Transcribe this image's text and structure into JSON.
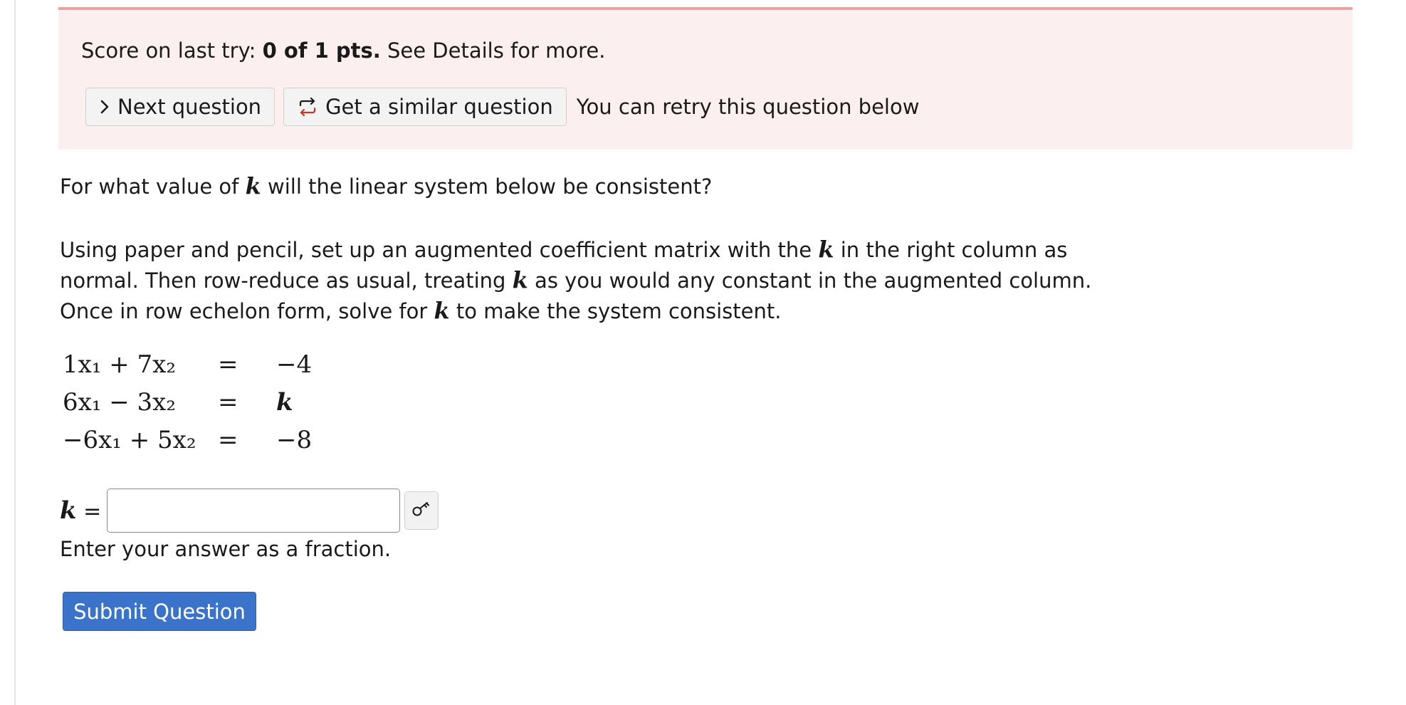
{
  "score_panel": {
    "score_prefix": "Score on last try: ",
    "score_value": "0 of 1 pts.",
    "score_suffix": " See Details for more.",
    "next_button": "Next question",
    "similar_button": "Get a similar question",
    "retry_text": "You can retry this question below"
  },
  "question": {
    "prompt_before": "For what value of ",
    "var": "k",
    "prompt_after": " will the linear system below be consistent?",
    "instructions": [
      {
        "before": "Using paper and pencil, set up an augmented coefficient matrix with the ",
        "after": " in the right column as"
      },
      {
        "before": "normal. Then row-reduce as usual, treating ",
        "after": " as you would any constant in the augmented column."
      },
      {
        "before": "Once in row echelon form, solve for ",
        "after": " to make the system consistent."
      }
    ],
    "system": [
      {
        "lhs": "1x₁ + 7x₂",
        "sign": "=",
        "rhs": "−4"
      },
      {
        "lhs": "6x₁ − 3x₂",
        "sign": "=",
        "rhs": "k"
      },
      {
        "lhs": "−6x₁ + 5x₂",
        "sign": "=",
        "rhs": "−8"
      }
    ]
  },
  "answer": {
    "label_var": "k",
    "label_eq": " =",
    "value": "",
    "placeholder": "",
    "key_icon": "key-icon",
    "hint": "Enter your answer as a fraction."
  },
  "submit_label": "Submit Question",
  "colors": {
    "panel_bg": "#fcefef",
    "panel_border": "#e8a2a2",
    "submit_bg": "#3a73c9"
  }
}
